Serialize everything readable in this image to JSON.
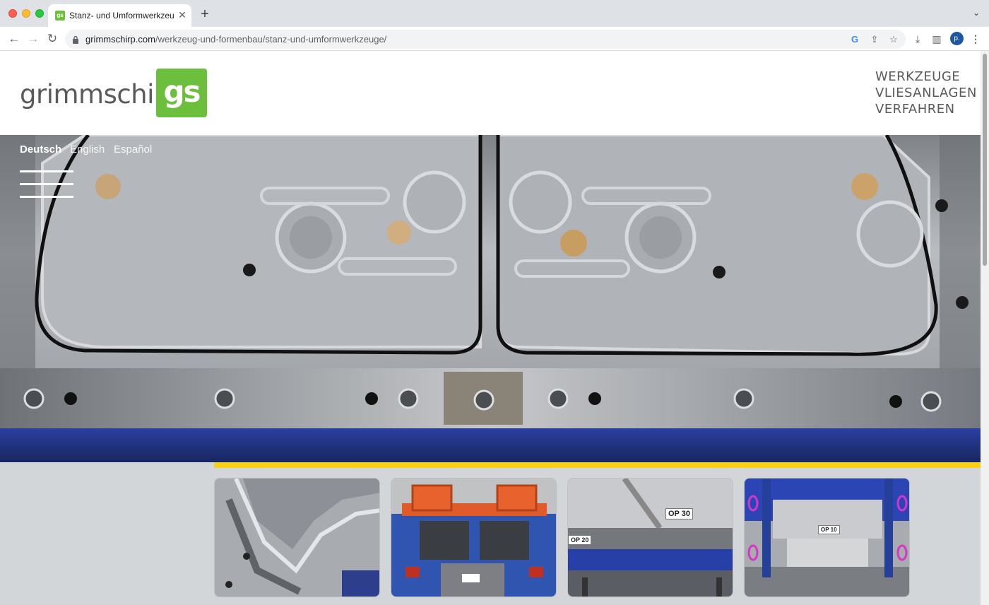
{
  "browser": {
    "tab_title": "Stanz- und Umformwerkzeuge",
    "url_host": "grimmschirp.com",
    "url_path": "/werkzeug-und-formenbau/stanz-und-umformwerkzeuge/",
    "profile_initial": "p.",
    "icons": [
      "back-icon",
      "forward-icon",
      "reload-icon",
      "lock-icon",
      "google-icon",
      "share-icon",
      "star-icon",
      "download-icon",
      "sidepanel-icon",
      "menu-icon"
    ]
  },
  "site": {
    "logo_text": "grimmschirp",
    "logo_mark": "gs",
    "nav": [
      "WERKZEUGE",
      "VLIESANLAGEN",
      "VERFAHREN"
    ],
    "languages": [
      "Deutsch",
      "English",
      "Español"
    ],
    "brand_green": "#6cbf3c",
    "accent_yellow": "#f7d117"
  },
  "thumbnails": [
    {
      "label": ""
    },
    {
      "label": ""
    },
    {
      "label": "OP 30",
      "label2": "OP 20"
    },
    {
      "label": "OP 10"
    }
  ]
}
